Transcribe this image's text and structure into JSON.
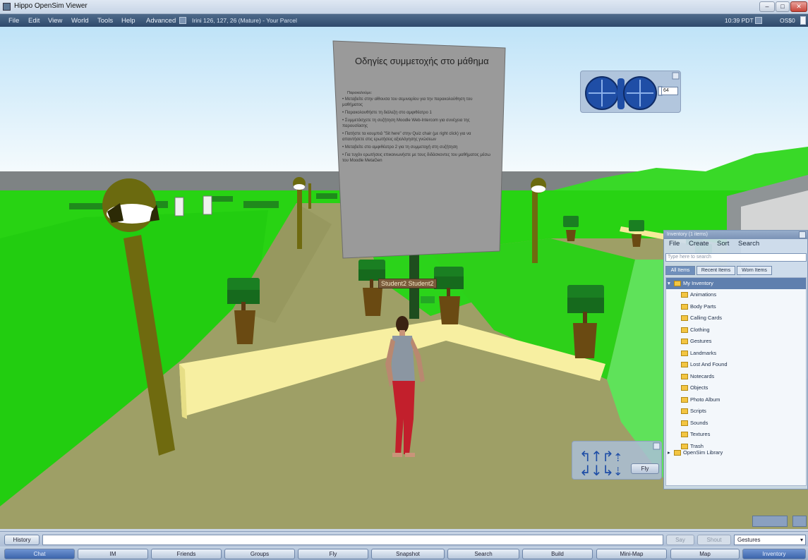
{
  "window": {
    "title": "Hippo OpenSim Viewer",
    "controls": [
      "–",
      "□",
      "✕"
    ]
  },
  "menubar": {
    "items": [
      "File",
      "Edit",
      "View",
      "World",
      "Tools",
      "Help",
      "Advanced"
    ],
    "location": "Irini 126, 127, 26 (Mature) - Your Parcel",
    "time": "10:39 PDT",
    "balance": "OS$0"
  },
  "world": {
    "sign": {
      "title": "Οδηγίες συμμετοχής στο μάθημα",
      "lines": [
        "Παρακαλούμε:",
        "• Μεταβείτε στην αίθουσα του σεμιναρίου για την παρακολούθηση του μαθήματος",
        "• Παρακολουθήστε τη διάλεξη στο αμφιθέατρο 1",
        "• Συμμετάσχετε τη συζήτηση Moodle Web-Intercom για συνέχεια της παρουσίασης",
        "• Πατήστε τα κουμπιά \"Sit here\" στην Quiz chair (με right click) για να απαντήσετε στις ερωτήσεις αξιολόγησης γνώσεων",
        "• Μεταβείτε στο αμφιθέατρο 2 για τη συμμετοχή στη συζήτηση",
        "• Για τυχόν ερωτήσεις επικοινωνήστε με τους διδάσκοντες του μαθήματος μέσω του Moodle MetaGen"
      ]
    },
    "avatar_name": "Student2 Student2"
  },
  "camera_controls": {
    "zoom_value": "64"
  },
  "movement_controls": {
    "fly_label": "Fly"
  },
  "inventory": {
    "title": "Inventory (1 items)",
    "menu": [
      "File",
      "Create",
      "Sort",
      "Search"
    ],
    "search_placeholder": "Type here to search",
    "tabs": [
      "All Items",
      "Recent Items",
      "Worn Items"
    ],
    "root": "My Inventory",
    "folders": [
      "Animations",
      "Body Parts",
      "Calling Cards",
      "Clothing",
      "Gestures",
      "Landmarks",
      "Lost And Found",
      "Notecards",
      "Objects",
      "Photo Album",
      "Scripts",
      "Sounds",
      "Textures",
      "Trash"
    ],
    "library": "OpenSim Library"
  },
  "chat": {
    "history_label": "History",
    "input_value": "",
    "say_label": "Say",
    "shout_label": "Shout",
    "gestures_label": "Gestures"
  },
  "toolbar": {
    "buttons": [
      "Chat",
      "IM",
      "Friends",
      "Groups",
      "Fly",
      "Snapshot",
      "Search",
      "Build",
      "Mini-Map",
      "Map",
      "Inventory"
    ]
  },
  "colors": {
    "sky": "#cfe6f4",
    "grass": "#2ad418",
    "path": "#9a9a63",
    "walkway": "#f6ef9c",
    "sign": "#9b9b9b"
  }
}
